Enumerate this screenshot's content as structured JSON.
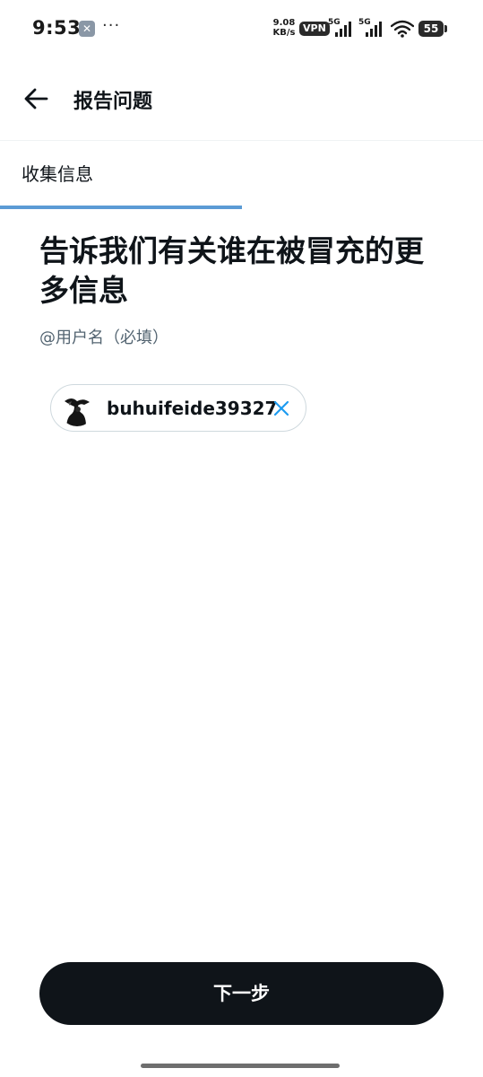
{
  "status_bar": {
    "time": "9:53",
    "app_icon_glyph": "✕",
    "more_dots": "···",
    "net_speed_value": "9.08",
    "net_speed_unit": "KB/s",
    "vpn": "VPN",
    "sim1_label": "5G",
    "sim2_label": "5G",
    "battery": "55"
  },
  "header": {
    "back_icon": "arrow-left-icon",
    "title": "报告问题"
  },
  "tab": {
    "label": "收集信息",
    "progress": 0.5,
    "progress_color": "#5b9bd5"
  },
  "main": {
    "title": "告诉我们有关谁在被冒充的更多信息",
    "subtitle": "@用户名（必填）",
    "selected_user": {
      "username": "buhuifeide39327",
      "avatar_icon": "user-avatar",
      "remove_icon": "close-icon",
      "remove_color": "#1d9bf0"
    }
  },
  "footer": {
    "next_label": "下一步"
  }
}
